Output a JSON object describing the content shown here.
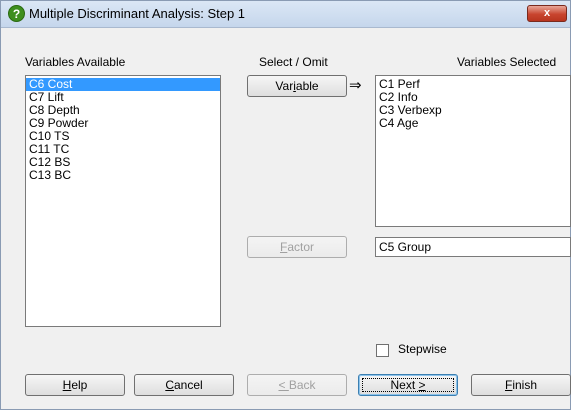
{
  "window": {
    "title": "Multiple Discriminant Analysis: Step 1",
    "close_glyph": "x"
  },
  "labels": {
    "variables_available": "Variables Available",
    "select_omit": "Select / Omit",
    "variables_selected": "Variables Selected"
  },
  "available_list": [
    {
      "text": "C6 Cost",
      "selected": true
    },
    {
      "text": "C7 Lift",
      "selected": false
    },
    {
      "text": "C8 Depth",
      "selected": false
    },
    {
      "text": "C9 Powder",
      "selected": false
    },
    {
      "text": "C10 TS",
      "selected": false
    },
    {
      "text": "C11 TC",
      "selected": false
    },
    {
      "text": "C12 BS",
      "selected": false
    },
    {
      "text": "C13 BC",
      "selected": false
    }
  ],
  "selected_list": [
    "C1 Perf",
    "C2 Info",
    "C3 Verbexp",
    "C4 Age"
  ],
  "variable_button": {
    "pre": "Var",
    "accel": "i",
    "post": "able"
  },
  "arrow_glyph": "⇒",
  "factor_button": {
    "pre": "",
    "accel": "F",
    "post": "actor"
  },
  "factor_value": "C5 Group",
  "stepwise": {
    "label": "Stepwise",
    "checked": false
  },
  "buttons": {
    "help": {
      "pre": "",
      "accel": "H",
      "post": "elp"
    },
    "cancel": {
      "pre": "",
      "accel": "C",
      "post": "ancel"
    },
    "back": {
      "pre": "",
      "accel": "< ",
      "post": "Back"
    },
    "next": {
      "pre": "Next ",
      "accel": ">",
      "post": ""
    },
    "finish": {
      "pre": "",
      "accel": "F",
      "post": "inish"
    }
  },
  "icons": {
    "app": "help-question-icon",
    "close": "close-icon"
  },
  "colors": {
    "selection": "#3399ff",
    "app_icon": "#3e8f1e",
    "close": "#c8452f"
  }
}
